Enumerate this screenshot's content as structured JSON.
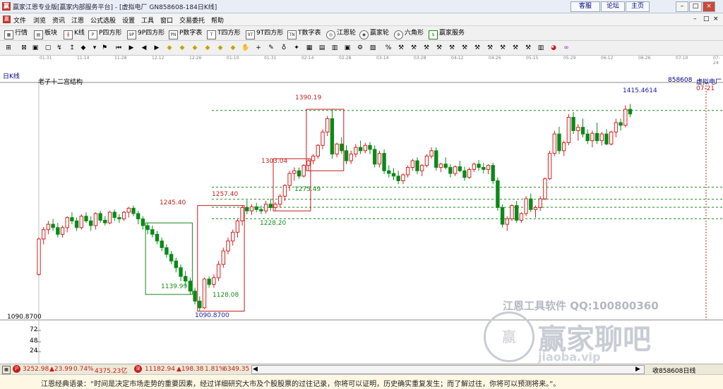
{
  "window": {
    "title": "赢家江恩专业版[赢家内部服务平台] - [虚拟电厂   GN858608-184日K线]",
    "links": [
      "客服",
      "论坛",
      "主页"
    ],
    "controls": [
      "–",
      "□",
      "×"
    ]
  },
  "menu": {
    "items": [
      "文件",
      "浏览",
      "资讯",
      "江恩",
      "公式选股",
      "设置",
      "工具",
      "窗口",
      "交易委托",
      "帮助"
    ],
    "right_controls": [
      "–",
      "□",
      "×"
    ]
  },
  "toolbar": {
    "items": [
      "行情",
      "板块",
      "K线",
      "P四方形",
      "9P四方形",
      "P数字表",
      "T四方形",
      "9T四方形",
      "T数字表",
      "江恩轮",
      "赢家轮",
      "六角形",
      "赢家服务"
    ]
  },
  "date_axis": [
    "01-31",
    "11-14",
    "11-28",
    "12-12",
    "12-26",
    "01-10",
    "01-31",
    "02-14",
    "02-28",
    "03-14",
    "03-28",
    "04-12",
    "04-26",
    "05-15",
    "05-29",
    "06-12",
    "06-26",
    "07-10",
    "07-24"
  ],
  "chart_panel": {
    "period_label": "日K线",
    "indicator_name": "老子十二宫结构",
    "stock_code": "858608",
    "stock_name": "虚拟电厂",
    "date_marker": "07-21",
    "price_labels": [
      "1090.8700",
      "1139.99",
      "1128.08",
      "1245.40",
      "1257.40",
      "1228.20",
      "1303.04",
      "1275.49",
      "1390.19",
      "1415.4614"
    ],
    "axis_low_label": "1090.8700"
  },
  "volume_axis": {
    "ticks": [
      "72",
      "48",
      "24"
    ]
  },
  "watermark": {
    "line1": "江恩工具软件  QQ:100800360",
    "logo_text": "赢家聊吧",
    "url_text": "jiaoba.vip"
  },
  "statusbar": {
    "index1": {
      "value": "3252.98",
      "change": "▲23.99",
      "pct": "0.74%",
      "amount": "4375.23亿"
    },
    "index2": {
      "value": "11182.94",
      "change": "▲198.38",
      "pct": "1.81%",
      "amount": "6349.35"
    },
    "right_text": "收858608日线"
  },
  "quote": "江恩经典语录：“时间是决定市场走势的重要因素，经过详细研究大市及个股股票的过往记录，你将可以证明，历史确实重复发生；而了解过往，你将可以预测将来。”。",
  "colors": {
    "up": "#d62020",
    "down": "#0a8a18",
    "box_red": "#c81c1c",
    "box_green": "#188a18",
    "label_blue": "#1a1aa6"
  },
  "chart_data": {
    "type": "candlestick",
    "title": "老子十二宫结构",
    "candles": [
      [
        1145,
        1200,
        1143,
        1198
      ],
      [
        1198,
        1216,
        1190,
        1212
      ],
      [
        1212,
        1225,
        1205,
        1220
      ],
      [
        1220,
        1228,
        1210,
        1215
      ],
      [
        1215,
        1222,
        1200,
        1205
      ],
      [
        1205,
        1218,
        1200,
        1215
      ],
      [
        1215,
        1232,
        1208,
        1230
      ],
      [
        1230,
        1238,
        1220,
        1225
      ],
      [
        1225,
        1230,
        1210,
        1215
      ],
      [
        1215,
        1235,
        1212,
        1232
      ],
      [
        1232,
        1238,
        1222,
        1225
      ],
      [
        1225,
        1232,
        1210,
        1218
      ],
      [
        1218,
        1238,
        1212,
        1236
      ],
      [
        1236,
        1240,
        1222,
        1226
      ],
      [
        1226,
        1232,
        1218,
        1222
      ],
      [
        1222,
        1240,
        1220,
        1238
      ],
      [
        1238,
        1242,
        1225,
        1230
      ],
      [
        1230,
        1235,
        1222,
        1228
      ],
      [
        1228,
        1240,
        1225,
        1238
      ],
      [
        1238,
        1246,
        1230,
        1244
      ],
      [
        1244,
        1248,
        1232,
        1236
      ],
      [
        1236,
        1240,
        1220,
        1228
      ],
      [
        1228,
        1232,
        1212,
        1218
      ],
      [
        1218,
        1222,
        1205,
        1212
      ],
      [
        1212,
        1218,
        1200,
        1205
      ],
      [
        1205,
        1210,
        1190,
        1195
      ],
      [
        1195,
        1200,
        1180,
        1185
      ],
      [
        1185,
        1190,
        1170,
        1175
      ],
      [
        1175,
        1180,
        1160,
        1165
      ],
      [
        1165,
        1170,
        1148,
        1155
      ],
      [
        1155,
        1160,
        1135,
        1142
      ],
      [
        1142,
        1150,
        1128,
        1135
      ],
      [
        1135,
        1140,
        1115,
        1120
      ],
      [
        1120,
        1125,
        1100,
        1105
      ],
      [
        1105,
        1112,
        1090,
        1095
      ],
      [
        1095,
        1140,
        1093,
        1138
      ],
      [
        1138,
        1142,
        1125,
        1130
      ],
      [
        1130,
        1145,
        1125,
        1140
      ],
      [
        1140,
        1165,
        1135,
        1160
      ],
      [
        1160,
        1185,
        1155,
        1180
      ],
      [
        1180,
        1200,
        1175,
        1195
      ],
      [
        1195,
        1212,
        1188,
        1208
      ],
      [
        1208,
        1228,
        1200,
        1225
      ],
      [
        1225,
        1248,
        1218,
        1245
      ],
      [
        1245,
        1256,
        1235,
        1240
      ],
      [
        1240,
        1250,
        1234,
        1246
      ],
      [
        1246,
        1252,
        1238,
        1242
      ],
      [
        1242,
        1248,
        1235,
        1240
      ],
      [
        1240,
        1255,
        1236,
        1250
      ],
      [
        1250,
        1258,
        1240,
        1245
      ],
      [
        1245,
        1253,
        1240,
        1250
      ],
      [
        1250,
        1265,
        1245,
        1262
      ],
      [
        1262,
        1280,
        1255,
        1278
      ],
      [
        1278,
        1300,
        1270,
        1296
      ],
      [
        1296,
        1305,
        1285,
        1300
      ],
      [
        1300,
        1305,
        1288,
        1292
      ],
      [
        1292,
        1310,
        1290,
        1308
      ],
      [
        1308,
        1318,
        1300,
        1315
      ],
      [
        1315,
        1325,
        1310,
        1322
      ],
      [
        1322,
        1340,
        1318,
        1338
      ],
      [
        1338,
        1362,
        1332,
        1358
      ],
      [
        1358,
        1382,
        1352,
        1378
      ],
      [
        1378,
        1392,
        1318,
        1325
      ],
      [
        1325,
        1342,
        1320,
        1340
      ],
      [
        1340,
        1350,
        1325,
        1330
      ],
      [
        1330,
        1338,
        1310,
        1315
      ],
      [
        1315,
        1330,
        1310,
        1325
      ],
      [
        1325,
        1340,
        1320,
        1335
      ],
      [
        1335,
        1345,
        1325,
        1330
      ],
      [
        1330,
        1342,
        1326,
        1338
      ],
      [
        1338,
        1343,
        1325,
        1332
      ],
      [
        1332,
        1338,
        1305,
        1310
      ],
      [
        1310,
        1330,
        1305,
        1326
      ],
      [
        1326,
        1332,
        1295,
        1300
      ],
      [
        1300,
        1308,
        1290,
        1296
      ],
      [
        1296,
        1304,
        1286,
        1292
      ],
      [
        1292,
        1300,
        1280,
        1285
      ],
      [
        1285,
        1296,
        1280,
        1294
      ],
      [
        1294,
        1308,
        1290,
        1305
      ],
      [
        1305,
        1318,
        1300,
        1315
      ],
      [
        1315,
        1320,
        1295,
        1300
      ],
      [
        1300,
        1310,
        1292,
        1308
      ],
      [
        1308,
        1325,
        1305,
        1322
      ],
      [
        1322,
        1335,
        1318,
        1330
      ],
      [
        1330,
        1335,
        1300,
        1305
      ],
      [
        1305,
        1312,
        1298,
        1310
      ],
      [
        1310,
        1320,
        1302,
        1305
      ],
      [
        1305,
        1310,
        1290,
        1296
      ],
      [
        1296,
        1308,
        1292,
        1306
      ],
      [
        1306,
        1315,
        1298,
        1300
      ],
      [
        1300,
        1306,
        1285,
        1290
      ],
      [
        1290,
        1305,
        1288,
        1302
      ],
      [
        1302,
        1312,
        1298,
        1310
      ],
      [
        1310,
        1316,
        1300,
        1305
      ],
      [
        1305,
        1312,
        1296,
        1302
      ],
      [
        1302,
        1310,
        1295,
        1308
      ],
      [
        1308,
        1312,
        1280,
        1285
      ],
      [
        1285,
        1290,
        1240,
        1245
      ],
      [
        1245,
        1250,
        1215,
        1220
      ],
      [
        1220,
        1232,
        1210,
        1228
      ],
      [
        1228,
        1250,
        1225,
        1248
      ],
      [
        1248,
        1255,
        1222,
        1226
      ],
      [
        1226,
        1238,
        1222,
        1236
      ],
      [
        1236,
        1262,
        1232,
        1258
      ],
      [
        1258,
        1266,
        1238,
        1242
      ],
      [
        1242,
        1248,
        1230,
        1245
      ],
      [
        1245,
        1262,
        1240,
        1258
      ],
      [
        1258,
        1290,
        1256,
        1288
      ],
      [
        1288,
        1330,
        1286,
        1326
      ],
      [
        1326,
        1360,
        1322,
        1355
      ],
      [
        1355,
        1366,
        1325,
        1330
      ],
      [
        1330,
        1345,
        1322,
        1342
      ],
      [
        1342,
        1385,
        1338,
        1380
      ],
      [
        1380,
        1388,
        1355,
        1360
      ],
      [
        1360,
        1370,
        1345,
        1365
      ],
      [
        1365,
        1378,
        1350,
        1355
      ],
      [
        1355,
        1362,
        1340,
        1345
      ],
      [
        1345,
        1360,
        1335,
        1356
      ],
      [
        1356,
        1372,
        1340,
        1345
      ],
      [
        1345,
        1358,
        1338,
        1355
      ],
      [
        1355,
        1362,
        1338,
        1340
      ],
      [
        1340,
        1360,
        1338,
        1358
      ],
      [
        1358,
        1378,
        1350,
        1372
      ],
      [
        1372,
        1378,
        1360,
        1368
      ],
      [
        1368,
        1398,
        1365,
        1392
      ],
      [
        1392,
        1400,
        1380,
        1385
      ]
    ],
    "levels": [
      1245.4,
      1257.4,
      1228.2,
      1275.49,
      1390.19
    ],
    "ylim": [
      1080,
      1430
    ]
  }
}
